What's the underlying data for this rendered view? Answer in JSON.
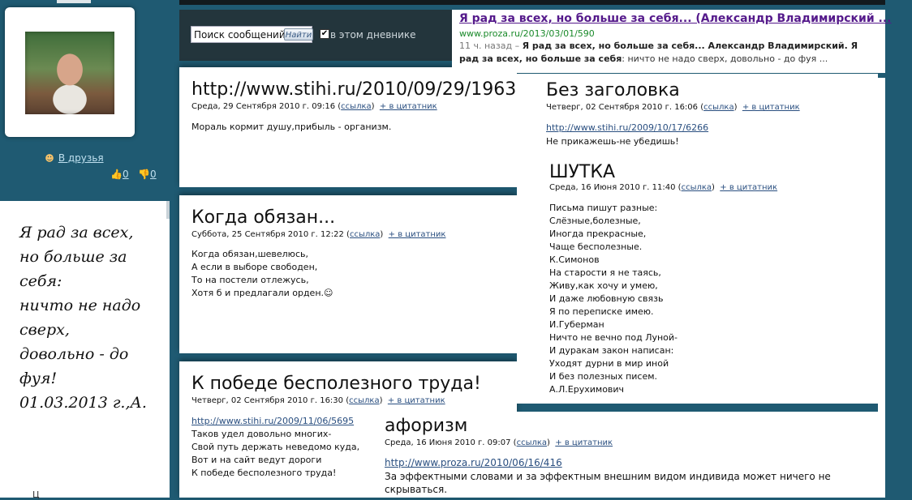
{
  "sidebar": {
    "friends_label": "В друзья",
    "likes": "0",
    "dislikes": "0",
    "epigraph": "Я рад за всех,\nно больше за себя:\nничто не надо сверх,\nдовольно - до фуя!\n01.03.2013 г.,А."
  },
  "search": {
    "input_value": "Поиск сообщений",
    "button_label": "Найти",
    "checkbox_label": "в этом дневнике"
  },
  "google_result": {
    "title": "Я рад за всех, но больше за себя... (Александр Владимирский ...",
    "url": "www.proza.ru/2013/03/01/590",
    "time": "11 ч. назад – ",
    "snippet_bold": "Я рад за всех, но больше за себя... Александр Владимирский. Я рад за всех, но больше за себя",
    "snippet_rest": ": ничто не надо сверх, довольно - до фуя ..."
  },
  "common": {
    "link_label": "ссылка",
    "quote_label": "+ в цитатник",
    "paren_open": " (",
    "paren_close": ")"
  },
  "posts": [
    {
      "title": "http://www.stihi.ru/2010/09/29/1963",
      "date": "Среда, 29 Сентября 2010 г. 09:16",
      "body": "Мораль кормит душу,прибыль - организм."
    },
    {
      "title": "Когда обязан...",
      "date": "Суббота, 25 Сентября 2010 г. 12:22",
      "body": "Когда обязан,шевелюсь,\nА если в выборе свободен,\nТо на постели отлежусь,\nХотя б и предлагали орден.☺"
    },
    {
      "title": "К победе бесполезного труда!",
      "date": "Четверг, 02 Сентября 2010 г. 16:30",
      "url": "http://www.stihi.ru/2009/11/06/5695",
      "body": "Таков удел довольно многих-\nСвой путь держать неведомо куда,\nВот и на сайт ведут дороги\nК победе бесполезного труда!"
    },
    {
      "title": "Без заголовка",
      "date": "Четверг, 02 Сентября 2010 г. 16:06",
      "url": "http://www.stihi.ru/2009/10/17/6266",
      "body": "Не прикажешь-не убедишь!"
    },
    {
      "title": "ШУТКА",
      "date": "Среда, 16 Июня 2010 г. 11:40",
      "body": "Письма пишут разные:\nСлёзные,болезные,\nИногда прекрасные,\nЧаще бесполезные.\nК.Симонов\nНа старости я не таясь,\nЖиву,как хочу и умею,\nИ даже любовную связь\nЯ по переписке имею.\nИ.Губерман\nНичто не вечно под Луной-\nИ дуракам закон написан:\nУходят дурни в мир иной\nИ без полезных писем.\nА.Л.Ерухимович"
    },
    {
      "title": "афоризм",
      "date": "Среда, 16 Июня 2010 г. 09:07",
      "url": "http://www.proza.ru/2010/06/16/416",
      "body": "За эффектными словами и за эффектным внешним видом индивида может ничего не скрываться."
    }
  ],
  "bottom_left_fragment": "Ц"
}
